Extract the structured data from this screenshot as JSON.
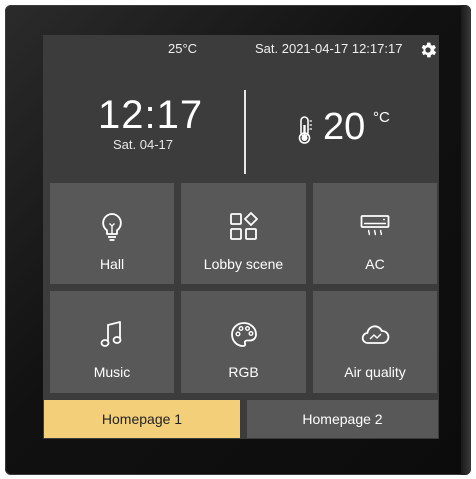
{
  "status_bar": {
    "temperature": "25°C",
    "datetime": "Sat. 2021-04-17 12:17:17",
    "settings_icon": "gear-icon"
  },
  "clock": {
    "time": "12:17",
    "date": "Sat. 04-17"
  },
  "climate": {
    "icon": "thermometer-icon",
    "temperature": "20",
    "unit": "°C"
  },
  "tiles": [
    {
      "label": "Hall",
      "icon": "lightbulb-icon"
    },
    {
      "label": "Lobby scene",
      "icon": "scene-grid-icon"
    },
    {
      "label": "AC",
      "icon": "air-conditioner-icon"
    },
    {
      "label": "Music",
      "icon": "music-note-icon"
    },
    {
      "label": "RGB",
      "icon": "palette-icon"
    },
    {
      "label": "Air quality",
      "icon": "cloud-icon"
    }
  ],
  "tabs": [
    {
      "label": "Homepage 1",
      "active": true
    },
    {
      "label": "Homepage 2",
      "active": false
    }
  ],
  "colors": {
    "screen_bg": "#3c3c3c",
    "tile_bg": "#585858",
    "active_tab": "#f3cf7a"
  }
}
